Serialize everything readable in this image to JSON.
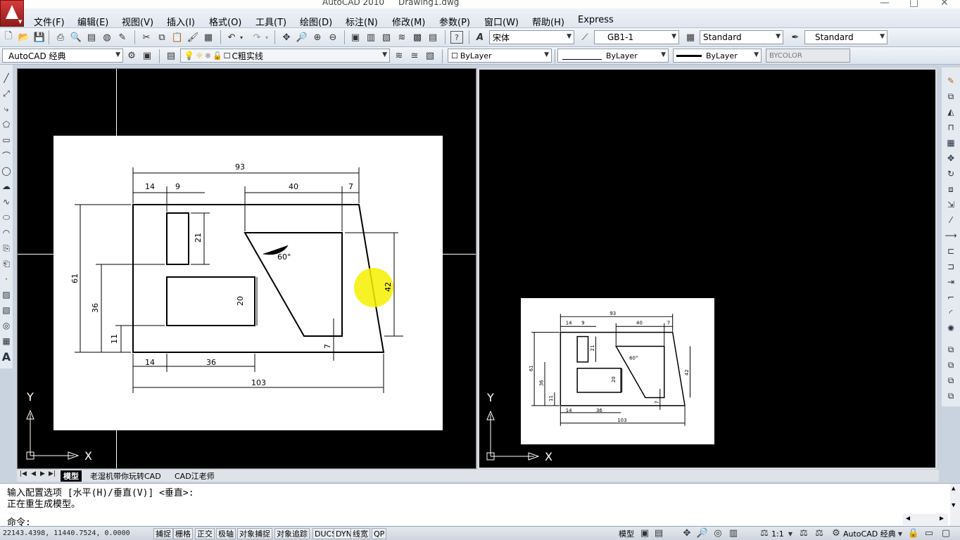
{
  "window": {
    "app": "AutoCAD 2010",
    "file": "Drawing1.dwg",
    "minimize": "—",
    "maximize": "□",
    "close": "✕"
  },
  "menu": [
    "文件(F)",
    "编辑(E)",
    "视图(V)",
    "插入(I)",
    "格式(O)",
    "工具(T)",
    "绘图(D)",
    "标注(N)",
    "修改(M)",
    "参数(P)",
    "窗口(W)",
    "帮助(H)",
    "Express"
  ],
  "toolbar": {
    "text_style": "宋体",
    "dim_style": "GB1-1",
    "table_style": "Standard",
    "multileader_style": "Standard",
    "workspace": "AutoCAD 经典",
    "layer": "C粗实线",
    "color": "ByLayer",
    "linetype": "ByLayer",
    "lineweight": "ByLayer",
    "plotstyle": "BYCOLOR"
  },
  "drawing": {
    "dims": {
      "total_top": "93",
      "d14": "14",
      "d9": "9",
      "d40": "40",
      "d7": "7",
      "d21": "21",
      "angle": "60°",
      "d42": "42",
      "d61": "61",
      "d36v": "36",
      "d20": "20",
      "d11": "11",
      "d7v": "7",
      "d14b": "14",
      "d36b": "36",
      "d103": "103"
    }
  },
  "ucs": {
    "y": "Y",
    "x": "X"
  },
  "tabs": {
    "model": "模型",
    "layout1": "老湿机带你玩转CAD",
    "layout2": "CAD江老师"
  },
  "command": {
    "line1": "输入配置选项 [水平(H)/垂直(V)] <垂直>:",
    "line2": "正在重生成模型。",
    "prompt": "命令:"
  },
  "status": {
    "coords": "22143.4398, 11440.7524, 0.0000",
    "buttons": [
      "捕捉",
      "栅格",
      "正交",
      "极轴",
      "对象捕捉",
      "对象追踪",
      "DUCS",
      "DYN",
      "线宽",
      "QP"
    ],
    "model": "模型",
    "scale": "1:1",
    "workspace": "AutoCAD 经典"
  },
  "colors": {
    "viewport_bg": "#000000",
    "paper": "#ffffff",
    "highlight": "#f5f000"
  }
}
